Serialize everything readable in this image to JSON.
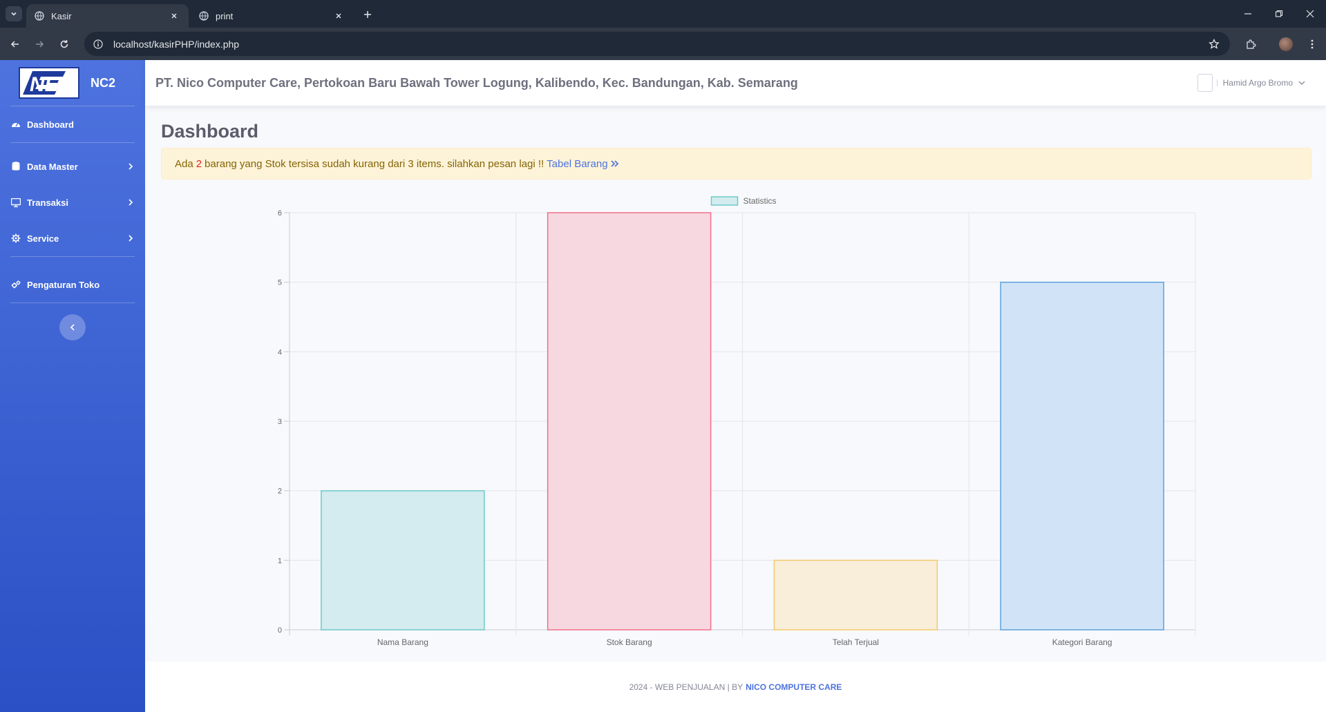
{
  "browser": {
    "tabs": [
      {
        "title": "Kasir",
        "active": true
      },
      {
        "title": "print",
        "active": false
      }
    ],
    "url": "localhost/kasirPHP/index.php"
  },
  "sidebar": {
    "brand_name": "NC2",
    "logo_text": "NE",
    "items": [
      {
        "label": "Dashboard",
        "icon": "gauge-icon"
      },
      {
        "label": "Data Master",
        "icon": "database-icon"
      },
      {
        "label": "Transaksi",
        "icon": "desktop-icon"
      },
      {
        "label": "Service",
        "icon": "gear-icon"
      },
      {
        "label": "Pengaturan Toko",
        "icon": "gears-icon"
      }
    ]
  },
  "topbar": {
    "company": "PT. Nico Computer Care, Pertokoan Baru Bawah Tower Logung, Kalibendo, Kec. Bandungan, Kab. Semarang",
    "user_name": "Hamid Argo Bromo"
  },
  "main": {
    "title": "Dashboard",
    "alert": {
      "prefix": "Ada",
      "count": "2",
      "suffix": "barang yang Stok tersisa sudah kurang dari 3 items. silahkan pesan lagi !!",
      "link_text": "Tabel Barang"
    }
  },
  "chart_data": {
    "type": "bar",
    "legend": "Statistics",
    "legend_position": "top-center",
    "categories": [
      "Nama Barang",
      "Stok Barang",
      "Telah Terjual",
      "Kategori Barang"
    ],
    "values": [
      2,
      6,
      1,
      5
    ],
    "ylim": [
      0,
      6
    ],
    "yticks": [
      0,
      1,
      2,
      3,
      4,
      5,
      6
    ],
    "grid": true,
    "colors": [
      {
        "fill": "#d4ecef",
        "stroke": "#6cc9c9"
      },
      {
        "fill": "#f7d8e0",
        "stroke": "#f0708a"
      },
      {
        "fill": "#f8eed9",
        "stroke": "#f5c96a"
      },
      {
        "fill": "#d1e3f6",
        "stroke": "#5aa2dc"
      }
    ]
  },
  "footer": {
    "text": "2024 - WEB PENJUALAN | BY",
    "brand": "NICO COMPUTER CARE"
  }
}
